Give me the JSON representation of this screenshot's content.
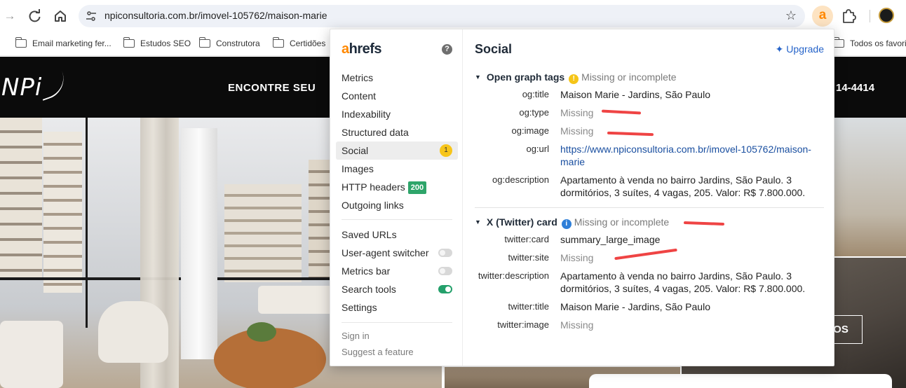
{
  "browser": {
    "url": "npiconsultoria.com.br/imovel-105762/maison-marie",
    "bookmarks": [
      "Email marketing fer...",
      "Estudos SEO",
      "Construtora",
      "Certidões",
      "Todos os favori"
    ]
  },
  "website": {
    "logo": "NPi",
    "nav_text": "ENCONTRE SEU",
    "phone_text": "14-4414",
    "button_text": "OS"
  },
  "ahrefs": {
    "brand_a": "a",
    "brand_rest": "hrefs",
    "menu": [
      {
        "label": "Metrics"
      },
      {
        "label": "Content"
      },
      {
        "label": "Indexability"
      },
      {
        "label": "Structured data"
      },
      {
        "label": "Social",
        "badge": "1"
      },
      {
        "label": "Images"
      },
      {
        "label": "HTTP headers",
        "badge": "200"
      },
      {
        "label": "Outgoing links"
      }
    ],
    "tools": [
      {
        "label": "Saved URLs"
      },
      {
        "label": "User-agent switcher"
      },
      {
        "label": "Metrics bar"
      },
      {
        "label": "Search tools"
      },
      {
        "label": "Settings"
      }
    ],
    "sign_in": "Sign in",
    "suggest": "Suggest a feature",
    "panel_title": "Social",
    "upgrade": "Upgrade",
    "og": {
      "title": "Open graph tags",
      "status": "Missing or incomplete",
      "rows": [
        {
          "label": "og:title",
          "value": "Maison Marie - Jardins, São Paulo"
        },
        {
          "label": "og:type",
          "value": "Missing"
        },
        {
          "label": "og:image",
          "value": "Missing"
        },
        {
          "label": "og:url",
          "value": "https://www.npiconsultoria.com.br/imovel-105762/maison-marie"
        },
        {
          "label": "og:description",
          "value": "Apartamento à venda no bairro Jardins, São Paulo. 3 dormitórios, 3 suítes, 4 vagas, 205. Valor: R$ 7.800.000."
        }
      ]
    },
    "twitter": {
      "title": "X (Twitter) card",
      "status": "Missing or incomplete",
      "rows": [
        {
          "label": "twitter:card",
          "value": "summary_large_image"
        },
        {
          "label": "twitter:site",
          "value": "Missing"
        },
        {
          "label": "twitter:description",
          "value": "Apartamento à venda no bairro Jardins, São Paulo. 3 dormitórios, 3 suítes, 4 vagas, 205. Valor: R$ 7.800.000."
        },
        {
          "label": "twitter:title",
          "value": "Maison Marie - Jardins, São Paulo"
        },
        {
          "label": "twitter:image",
          "value": "Missing"
        }
      ]
    }
  },
  "colors": {
    "ahrefs_orange": "#ff8800",
    "annotation_red": "#ef4444",
    "toggle_on": "#24a06b",
    "link_blue": "#1a4fa0"
  }
}
